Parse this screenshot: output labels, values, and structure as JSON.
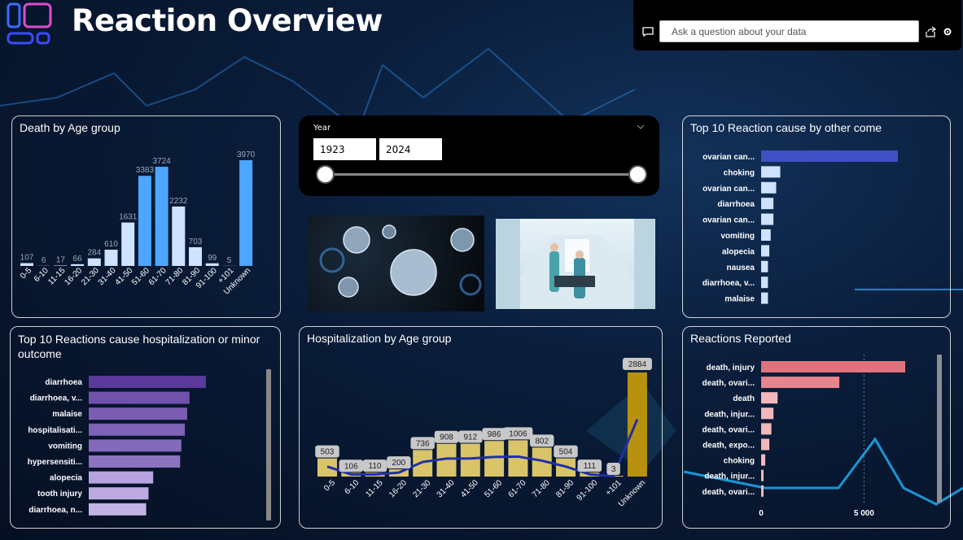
{
  "header": {
    "title": "Reaction Overview"
  },
  "qa": {
    "placeholder": "Ask a question about your data"
  },
  "slicer": {
    "label": "Year",
    "start": "1923",
    "end": "2024"
  },
  "colors": {
    "death_bar": "#4da6ff",
    "death_bar_light": "#cfe2ff",
    "cause_top": "#3f4fc4",
    "cause_other": "#cfe2ff",
    "hosp_purple": "#5a3a9a",
    "hosp_light": "#c9b8e8",
    "hosp_bar": "#d9c46a",
    "hosp_unknown": "#b8920f",
    "hosp_line": "#1f2fa8",
    "reported_top": "#e0737b",
    "reported_other": "#f2b8bc"
  },
  "cards": {
    "death_age": {
      "title": "Death by Age group"
    },
    "top_other": {
      "title": "Top 10 Reaction cause by other come"
    },
    "top_hosp": {
      "title": "Top 10 Reactions cause hospitalization or minor outcome"
    },
    "hosp_age": {
      "title": "Hospitalization by Age group"
    },
    "reported": {
      "title": "Reactions Reported"
    }
  },
  "chart_data": [
    {
      "type": "bar",
      "id": "death_age",
      "categories": [
        "0-5",
        "6-10",
        "11-15",
        "16-20",
        "21-30",
        "31-40",
        "41-50",
        "51-60",
        "61-70",
        "71-80",
        "81-90",
        "91-100",
        "+101",
        "Unknown"
      ],
      "values": [
        107,
        6,
        17,
        66,
        284,
        610,
        1631,
        3383,
        3724,
        2232,
        703,
        99,
        5,
        3970
      ]
    },
    {
      "type": "bar",
      "id": "top_other",
      "orientation": "horizontal",
      "categories": [
        "ovarian can...",
        "choking",
        "ovarian can...",
        "diarrhoea",
        "ovarian can...",
        "vomiting",
        "alopecia",
        "nausea",
        "diarrhoea, v...",
        "malaise"
      ],
      "values": [
        100,
        14,
        11,
        9,
        9,
        7,
        6,
        5,
        5,
        5
      ]
    },
    {
      "type": "bar",
      "id": "top_hosp",
      "orientation": "horizontal",
      "categories": [
        "diarrhoea",
        "diarrhoea, v...",
        "malaise",
        "hospitalisati...",
        "vomiting",
        "hypersensiti...",
        "alopecia",
        "tooth injury",
        "diarrhoea, n..."
      ],
      "values": [
        100,
        86,
        84,
        82,
        79,
        78,
        55,
        51,
        49
      ]
    },
    {
      "type": "bar",
      "id": "hosp_age",
      "categories": [
        "0-5",
        "6-10",
        "11-15",
        "16-20",
        "21-30",
        "31-40",
        "41-50",
        "51-60",
        "61-70",
        "71-80",
        "81-90",
        "91-100",
        "+101",
        "Unknown"
      ],
      "values": [
        503,
        106,
        110,
        200,
        736,
        908,
        912,
        986,
        1006,
        802,
        504,
        111,
        3,
        2884
      ]
    },
    {
      "type": "bar",
      "id": "reported",
      "orientation": "horizontal",
      "categories": [
        "death, injury",
        "death, ovari...",
        "death",
        "death, injur...",
        "death, ovari...",
        "death, expo...",
        "choking",
        "death, injur...",
        "death, ovari..."
      ],
      "values": [
        7000,
        3800,
        800,
        600,
        500,
        400,
        200,
        120,
        80
      ],
      "x_ticks": [
        "0",
        "5 000"
      ]
    }
  ]
}
